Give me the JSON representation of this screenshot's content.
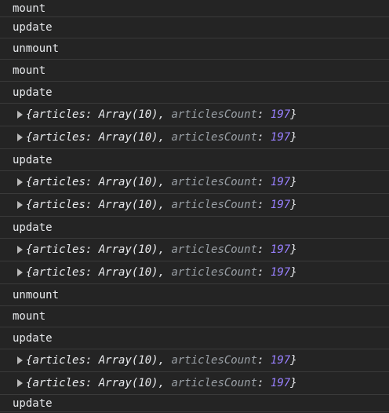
{
  "console": {
    "entries": [
      {
        "type": "text",
        "text": "mount"
      },
      {
        "type": "text",
        "text": "update"
      },
      {
        "type": "text",
        "text": "unmount"
      },
      {
        "type": "text",
        "text": "mount"
      },
      {
        "type": "text",
        "text": "update"
      },
      {
        "type": "object",
        "key1": "articles",
        "val1": "Array(10)",
        "key2": "articlesCount",
        "val2": "197"
      },
      {
        "type": "object",
        "key1": "articles",
        "val1": "Array(10)",
        "key2": "articlesCount",
        "val2": "197"
      },
      {
        "type": "text",
        "text": "update"
      },
      {
        "type": "object",
        "key1": "articles",
        "val1": "Array(10)",
        "key2": "articlesCount",
        "val2": "197"
      },
      {
        "type": "object",
        "key1": "articles",
        "val1": "Array(10)",
        "key2": "articlesCount",
        "val2": "197"
      },
      {
        "type": "text",
        "text": "update"
      },
      {
        "type": "object",
        "key1": "articles",
        "val1": "Array(10)",
        "key2": "articlesCount",
        "val2": "197"
      },
      {
        "type": "object",
        "key1": "articles",
        "val1": "Array(10)",
        "key2": "articlesCount",
        "val2": "197"
      },
      {
        "type": "text",
        "text": "unmount"
      },
      {
        "type": "text",
        "text": "mount"
      },
      {
        "type": "text",
        "text": "update"
      },
      {
        "type": "object",
        "key1": "articles",
        "val1": "Array(10)",
        "key2": "articlesCount",
        "val2": "197"
      },
      {
        "type": "object",
        "key1": "articles",
        "val1": "Array(10)",
        "key2": "articlesCount",
        "val2": "197"
      },
      {
        "type": "text",
        "text": "update"
      }
    ]
  },
  "colors": {
    "background": "#242424",
    "text": "#e8eaed",
    "dim_key": "#9aa0a6",
    "number": "#9980ff",
    "divider": "#3a3a3a"
  }
}
